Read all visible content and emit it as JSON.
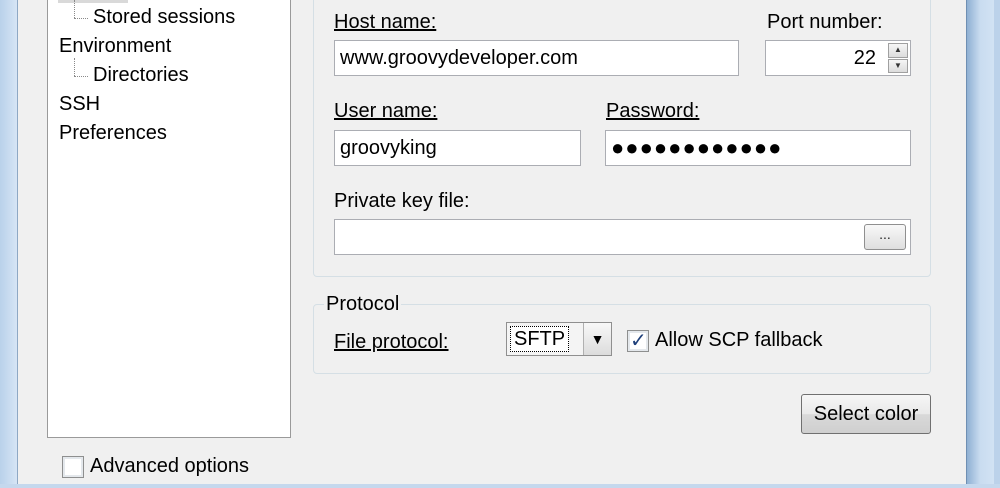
{
  "tree": {
    "items": [
      {
        "label": "Stored sessions"
      },
      {
        "label": "Environment"
      },
      {
        "label": "Directories"
      },
      {
        "label": "SSH"
      },
      {
        "label": "Preferences"
      }
    ]
  },
  "session": {
    "host_label": "Host name:",
    "host_value": "www.groovydeveloper.com",
    "port_label": "Port number:",
    "port_value": "22",
    "user_label": "User name:",
    "user_value": "groovyking",
    "password_label": "Password:",
    "password_mask": "●●●●●●●●●●●●",
    "key_label": "Private key file:",
    "key_value": "",
    "browse_label": "..."
  },
  "protocol": {
    "legend": "Protocol",
    "file_protocol_label": "File protocol:",
    "file_protocol_value": "SFTP",
    "allow_scp_label": "Allow SCP fallback",
    "allow_scp_checked": true
  },
  "buttons": {
    "select_color": "Select color"
  },
  "advanced": {
    "label": "Advanced options",
    "checked": false
  }
}
